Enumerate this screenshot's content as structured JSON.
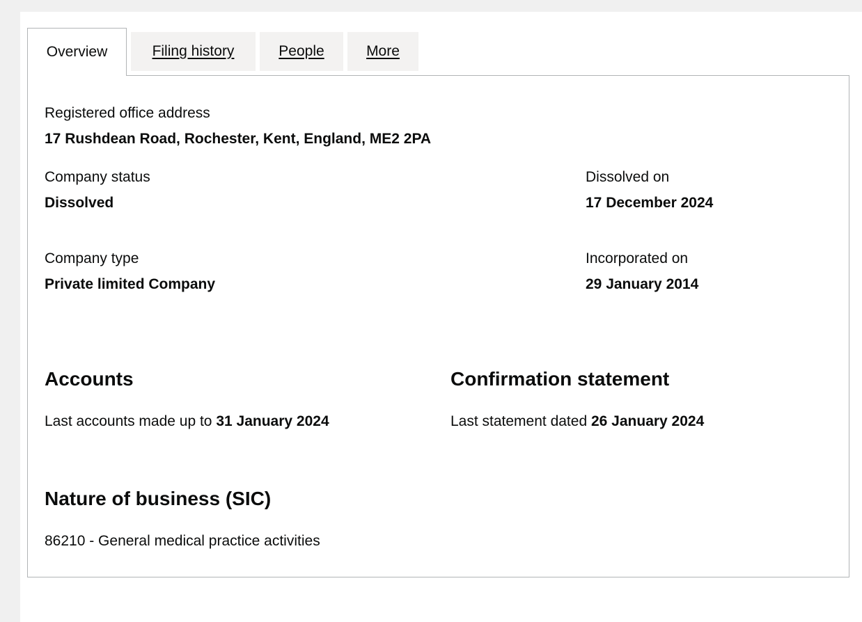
{
  "tabs": [
    {
      "label": "Overview",
      "active": true
    },
    {
      "label": "Filing history",
      "active": false
    },
    {
      "label": "People",
      "active": false
    },
    {
      "label": "More",
      "active": false
    }
  ],
  "overview": {
    "registered_office": {
      "label": "Registered office address",
      "value": "17 Rushdean Road, Rochester, Kent, England, ME2 2PA"
    },
    "company_status": {
      "label": "Company status",
      "value": "Dissolved"
    },
    "dissolved_on": {
      "label": "Dissolved on",
      "value": "17 December 2024"
    },
    "company_type": {
      "label": "Company type",
      "value": "Private limited Company"
    },
    "incorporated_on": {
      "label": "Incorporated on",
      "value": "29 January 2014"
    }
  },
  "accounts": {
    "heading": "Accounts",
    "text": "Last accounts made up to",
    "date": "31 January 2024"
  },
  "confirmation_statement": {
    "heading": "Confirmation statement",
    "text": "Last statement dated",
    "date": "26 January 2024"
  },
  "nature_of_business": {
    "heading": "Nature of business (SIC)",
    "items": [
      "86210 - General medical practice activities"
    ]
  },
  "colors": {
    "page_background": "#f0f0f0",
    "tab_inactive_background": "#f3f2f1",
    "border": "#b1b4b6",
    "text": "#0b0c0c"
  }
}
